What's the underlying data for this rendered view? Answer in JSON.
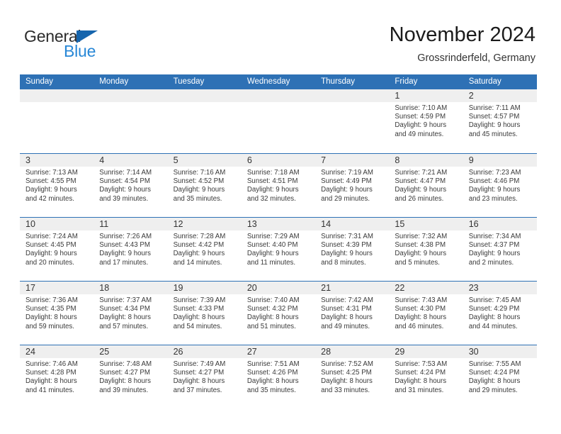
{
  "brand": {
    "name_part1": "General",
    "name_part2": "Blue",
    "accent_color": "#2787d6",
    "triangle_color": "#1665ad"
  },
  "header": {
    "title": "November 2024",
    "subtitle": "Grossrinderfeld, Germany",
    "header_bar_color": "#2e71b5",
    "day_band_color": "#efefef"
  },
  "weekdays": [
    "Sunday",
    "Monday",
    "Tuesday",
    "Wednesday",
    "Thursday",
    "Friday",
    "Saturday"
  ],
  "weeks": [
    [
      {
        "day": "",
        "info": ""
      },
      {
        "day": "",
        "info": ""
      },
      {
        "day": "",
        "info": ""
      },
      {
        "day": "",
        "info": ""
      },
      {
        "day": "",
        "info": ""
      },
      {
        "day": "1",
        "info": "Sunrise: 7:10 AM\nSunset: 4:59 PM\nDaylight: 9 hours\nand 49 minutes."
      },
      {
        "day": "2",
        "info": "Sunrise: 7:11 AM\nSunset: 4:57 PM\nDaylight: 9 hours\nand 45 minutes."
      }
    ],
    [
      {
        "day": "3",
        "info": "Sunrise: 7:13 AM\nSunset: 4:55 PM\nDaylight: 9 hours\nand 42 minutes."
      },
      {
        "day": "4",
        "info": "Sunrise: 7:14 AM\nSunset: 4:54 PM\nDaylight: 9 hours\nand 39 minutes."
      },
      {
        "day": "5",
        "info": "Sunrise: 7:16 AM\nSunset: 4:52 PM\nDaylight: 9 hours\nand 35 minutes."
      },
      {
        "day": "6",
        "info": "Sunrise: 7:18 AM\nSunset: 4:51 PM\nDaylight: 9 hours\nand 32 minutes."
      },
      {
        "day": "7",
        "info": "Sunrise: 7:19 AM\nSunset: 4:49 PM\nDaylight: 9 hours\nand 29 minutes."
      },
      {
        "day": "8",
        "info": "Sunrise: 7:21 AM\nSunset: 4:47 PM\nDaylight: 9 hours\nand 26 minutes."
      },
      {
        "day": "9",
        "info": "Sunrise: 7:23 AM\nSunset: 4:46 PM\nDaylight: 9 hours\nand 23 minutes."
      }
    ],
    [
      {
        "day": "10",
        "info": "Sunrise: 7:24 AM\nSunset: 4:45 PM\nDaylight: 9 hours\nand 20 minutes."
      },
      {
        "day": "11",
        "info": "Sunrise: 7:26 AM\nSunset: 4:43 PM\nDaylight: 9 hours\nand 17 minutes."
      },
      {
        "day": "12",
        "info": "Sunrise: 7:28 AM\nSunset: 4:42 PM\nDaylight: 9 hours\nand 14 minutes."
      },
      {
        "day": "13",
        "info": "Sunrise: 7:29 AM\nSunset: 4:40 PM\nDaylight: 9 hours\nand 11 minutes."
      },
      {
        "day": "14",
        "info": "Sunrise: 7:31 AM\nSunset: 4:39 PM\nDaylight: 9 hours\nand 8 minutes."
      },
      {
        "day": "15",
        "info": "Sunrise: 7:32 AM\nSunset: 4:38 PM\nDaylight: 9 hours\nand 5 minutes."
      },
      {
        "day": "16",
        "info": "Sunrise: 7:34 AM\nSunset: 4:37 PM\nDaylight: 9 hours\nand 2 minutes."
      }
    ],
    [
      {
        "day": "17",
        "info": "Sunrise: 7:36 AM\nSunset: 4:35 PM\nDaylight: 8 hours\nand 59 minutes."
      },
      {
        "day": "18",
        "info": "Sunrise: 7:37 AM\nSunset: 4:34 PM\nDaylight: 8 hours\nand 57 minutes."
      },
      {
        "day": "19",
        "info": "Sunrise: 7:39 AM\nSunset: 4:33 PM\nDaylight: 8 hours\nand 54 minutes."
      },
      {
        "day": "20",
        "info": "Sunrise: 7:40 AM\nSunset: 4:32 PM\nDaylight: 8 hours\nand 51 minutes."
      },
      {
        "day": "21",
        "info": "Sunrise: 7:42 AM\nSunset: 4:31 PM\nDaylight: 8 hours\nand 49 minutes."
      },
      {
        "day": "22",
        "info": "Sunrise: 7:43 AM\nSunset: 4:30 PM\nDaylight: 8 hours\nand 46 minutes."
      },
      {
        "day": "23",
        "info": "Sunrise: 7:45 AM\nSunset: 4:29 PM\nDaylight: 8 hours\nand 44 minutes."
      }
    ],
    [
      {
        "day": "24",
        "info": "Sunrise: 7:46 AM\nSunset: 4:28 PM\nDaylight: 8 hours\nand 41 minutes."
      },
      {
        "day": "25",
        "info": "Sunrise: 7:48 AM\nSunset: 4:27 PM\nDaylight: 8 hours\nand 39 minutes."
      },
      {
        "day": "26",
        "info": "Sunrise: 7:49 AM\nSunset: 4:27 PM\nDaylight: 8 hours\nand 37 minutes."
      },
      {
        "day": "27",
        "info": "Sunrise: 7:51 AM\nSunset: 4:26 PM\nDaylight: 8 hours\nand 35 minutes."
      },
      {
        "day": "28",
        "info": "Sunrise: 7:52 AM\nSunset: 4:25 PM\nDaylight: 8 hours\nand 33 minutes."
      },
      {
        "day": "29",
        "info": "Sunrise: 7:53 AM\nSunset: 4:24 PM\nDaylight: 8 hours\nand 31 minutes."
      },
      {
        "day": "30",
        "info": "Sunrise: 7:55 AM\nSunset: 4:24 PM\nDaylight: 8 hours\nand 29 minutes."
      }
    ]
  ]
}
